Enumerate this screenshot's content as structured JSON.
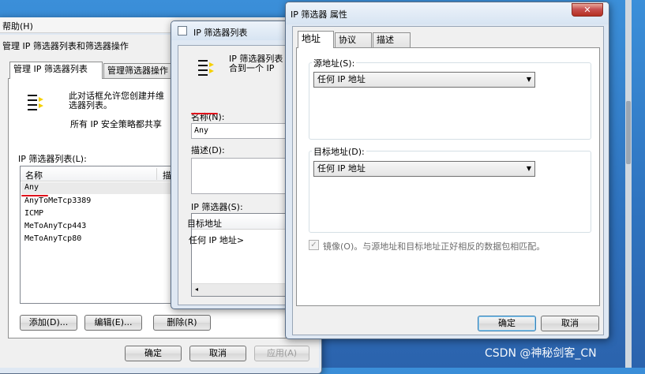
{
  "manage_window": {
    "menu_help": "帮助(H)",
    "title": "管理 IP 筛选器列表和筛选器操作",
    "tabs": [
      "管理 IP 筛选器列表",
      "管理筛选器操作"
    ],
    "intro_text_1": "此对话框允许您创建并维",
    "intro_text_2": "选器列表。",
    "intro_text_3": "所有 IP 安全策略都共享",
    "list_label": "IP 筛选器列表(L):",
    "list_headers": [
      "名称",
      "描"
    ],
    "list_items": [
      "Any",
      "AnyToMeTcp3389",
      "ICMP",
      "MeToAnyTcp443",
      "MeToAnyTcp80"
    ],
    "buttons": {
      "add": "添加(D)...",
      "edit": "编辑(E)...",
      "delete": "删除(R)"
    },
    "footer": {
      "ok": "确定",
      "cancel": "取消",
      "apply": "应用(A)"
    }
  },
  "filter_list_window": {
    "title": "IP 筛选器列表",
    "intro_text_1": "IP 筛选器列表",
    "intro_text_2": "合到一个 IP",
    "name_label": "名称(N):",
    "name_value": "Any",
    "desc_label": "描述(D):",
    "filters_label": "IP 筛选器(S):",
    "filters_header": "目标地址",
    "filters_row": "任何 IP 地址>"
  },
  "properties_window": {
    "title": "IP 筛选器 属性",
    "close_symbol": "✕",
    "tabs": [
      "地址",
      "协议",
      "描述"
    ],
    "source_label": "源地址(S):",
    "source_value": "任何 IP 地址",
    "dest_label": "目标地址(D):",
    "dest_value": "任何 IP 地址",
    "mirror_label": "镜像(O)。与源地址和目标地址正好相反的数据包相匹配。",
    "mirror_checked": "✓",
    "ok": "确定",
    "cancel": "取消"
  },
  "watermark": "CSDN @神秘剑客_CN",
  "colors": {
    "annotation_red": "#e0121b",
    "desktop": "#2f74c0"
  }
}
